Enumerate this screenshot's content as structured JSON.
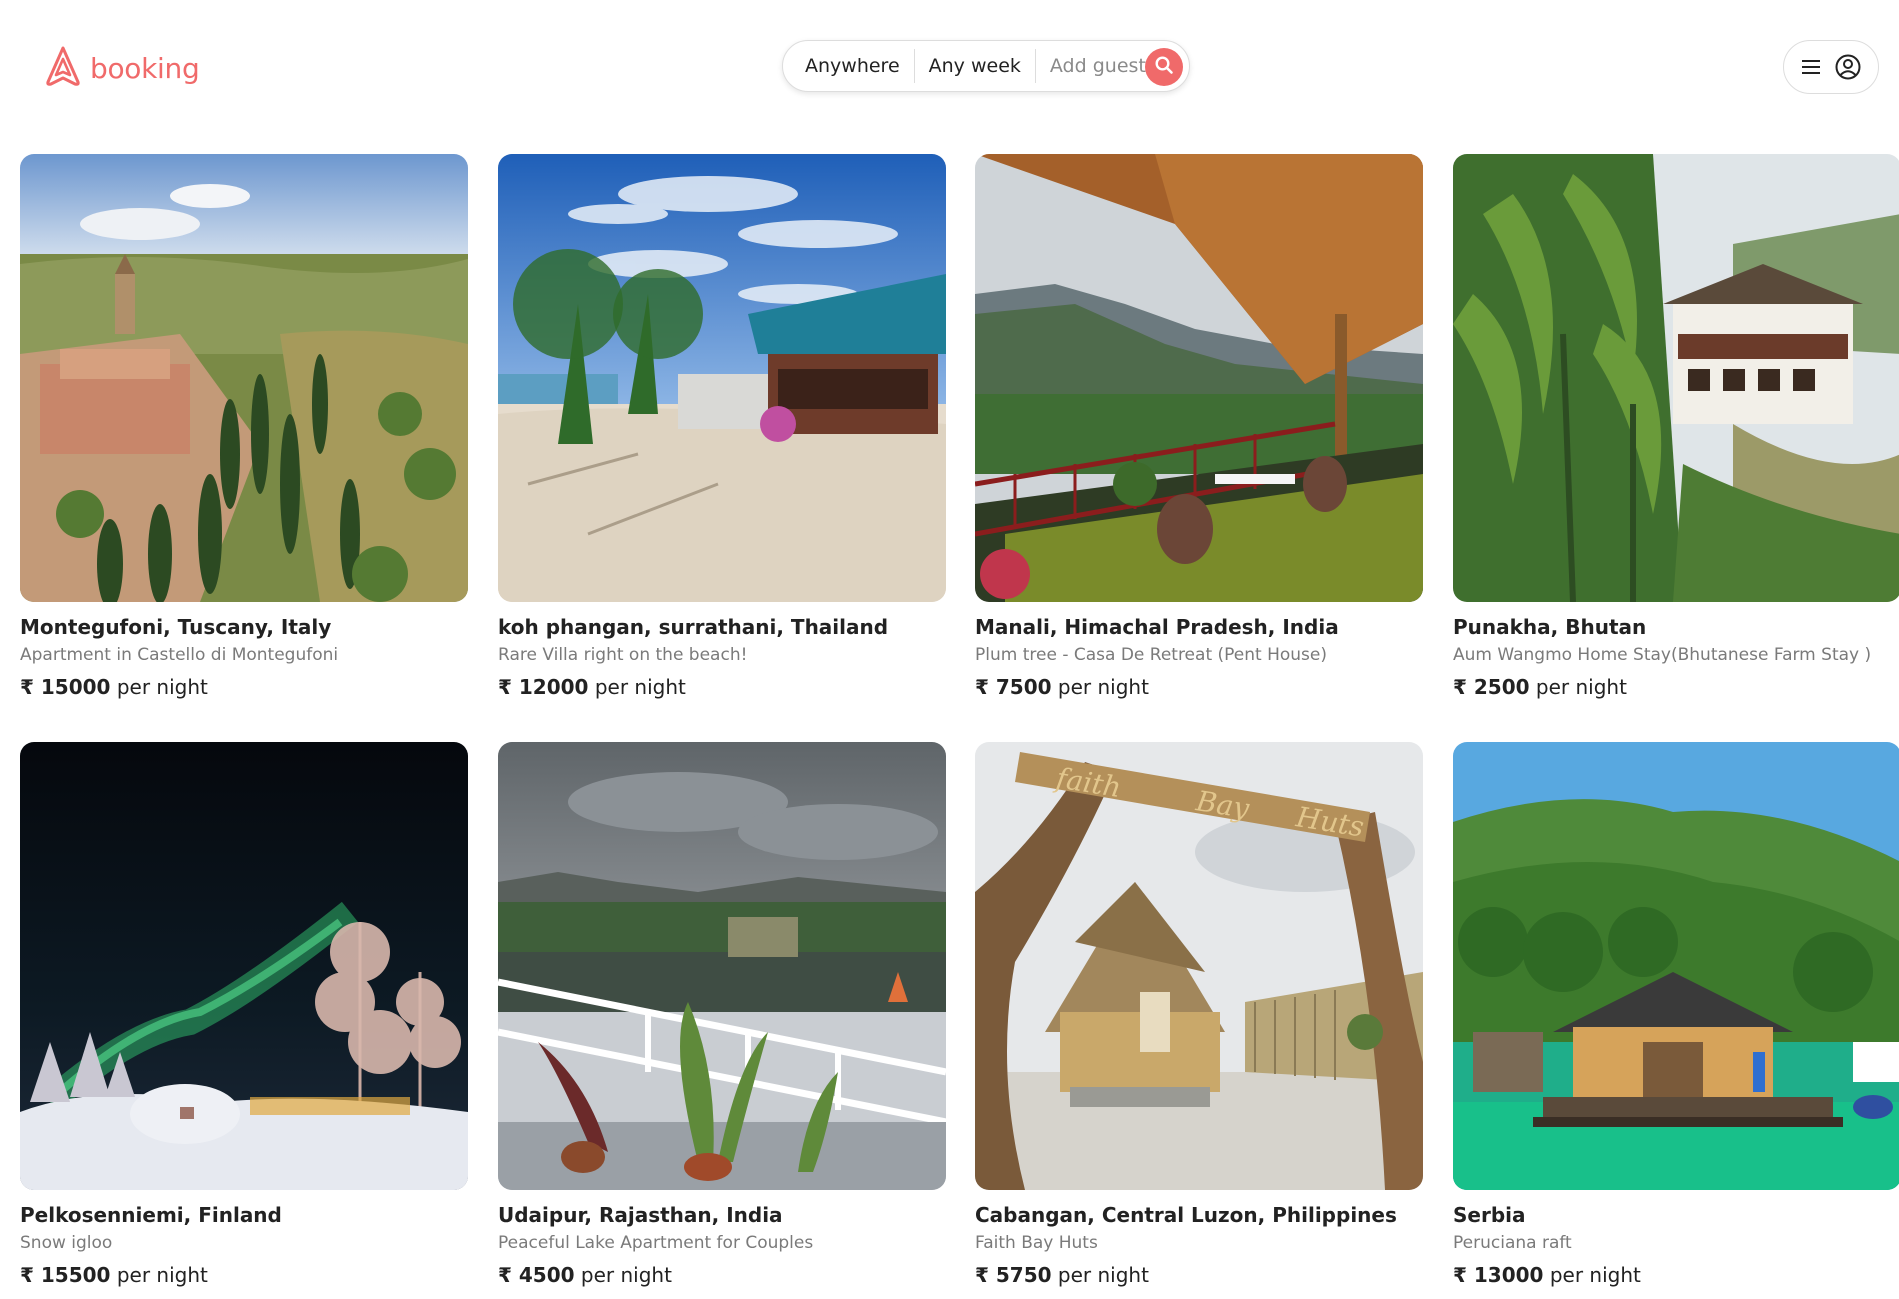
{
  "brand": {
    "name": "booking",
    "color": "#F06A6A",
    "logo_icon": "airbnb-belo-icon"
  },
  "search": {
    "location": "Anywhere",
    "week": "Any week",
    "guests_placeholder": "Add guests",
    "button_icon": "search-icon"
  },
  "user_menu": {
    "menu_icon": "hamburger-icon",
    "avatar_icon": "user-circle-icon"
  },
  "currency_symbol": "₹",
  "listings": [
    {
      "title": "Montegufoni, Tuscany, Italy",
      "subtitle": "Apartment in Castello di Montegufoni",
      "amount": "₹ 15000",
      "unit": "per night",
      "image": "tuscany-castle-hills"
    },
    {
      "title": "koh phangan, surrathani, Thailand",
      "subtitle": "Rare Villa right on the beach!",
      "amount": "₹ 12000",
      "unit": "per night",
      "image": "beach-villa-palms"
    },
    {
      "title": "Manali, Himachal Pradesh, India",
      "subtitle": "Plum tree - Casa De Retreat (Pent House)",
      "amount": "₹ 7500",
      "unit": "per night",
      "image": "mountain-balcony"
    },
    {
      "title": "Punakha, Bhutan",
      "subtitle": "Aum Wangmo Home Stay(Bhutanese Farm Stay )",
      "amount": "₹ 2500",
      "unit": "per night",
      "image": "bhutan-farmhouse"
    },
    {
      "title": "Pelkosenniemi, Finland",
      "subtitle": "Snow igloo",
      "amount": "₹ 15500",
      "unit": "per night",
      "image": "aurora-igloo"
    },
    {
      "title": "Udaipur, Rajasthan, India",
      "subtitle": "Peaceful Lake Apartment for Couples",
      "amount": "₹ 4500",
      "unit": "per night",
      "image": "lake-balcony"
    },
    {
      "title": "Cabangan, Central Luzon, Philippines",
      "subtitle": "Faith Bay Huts",
      "amount": "₹ 5750",
      "unit": "per night",
      "image": "faith-bay-hut"
    },
    {
      "title": "Serbia",
      "subtitle": "Peruciana raft",
      "amount": "₹ 13000",
      "unit": "per night",
      "image": "river-raft-house"
    }
  ]
}
